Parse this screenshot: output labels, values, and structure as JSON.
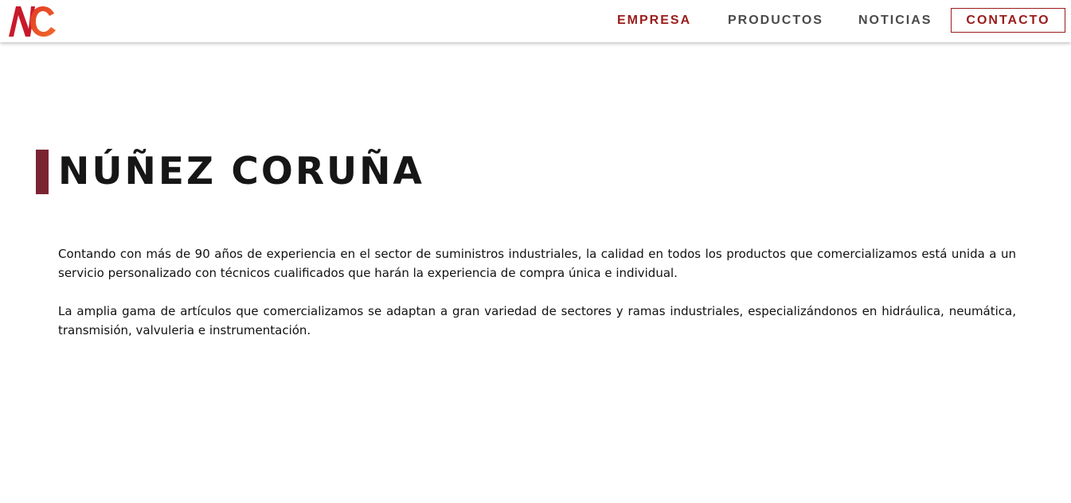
{
  "header": {
    "logo_alt": "NC",
    "nav": {
      "empresa": "EMPRESA",
      "productos": "PRODUCTOS",
      "noticias": "NOTICIAS",
      "contacto": "CONTACTO"
    }
  },
  "main": {
    "title": "NÚÑEZ CORUÑA",
    "paragraphs": [
      "Contando con más de 90 años de experiencia en el sector de suministros industriales, la calidad en todos los productos que comercializamos está unida a un servicio personalizado con técnicos cualificados que harán la experiencia de compra única e individual.",
      "La amplia gama de artículos que comercializamos se adaptan a gran variedad de sectores y ramas industriales, especializándonos en hidráulica, neumática, transmisión, valvuleria e instrumentación."
    ]
  },
  "colors": {
    "brand_red": "#9b1b1b",
    "nav_gray": "#4a4a4a",
    "title_accent": "#7a2432",
    "logo_orange": "#f06a2b"
  },
  "icons": {
    "logo": "nc-logo-icon"
  }
}
